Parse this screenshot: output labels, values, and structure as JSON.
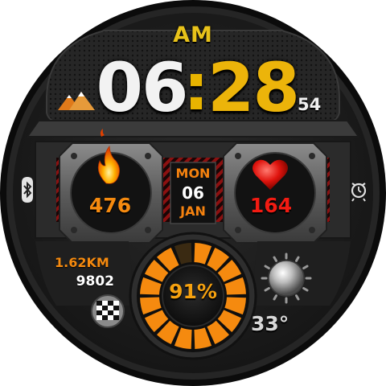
{
  "time": {
    "ampm": "AM",
    "hour": "06",
    "separator": ":",
    "minute": "28",
    "seconds": "54"
  },
  "date": {
    "day_of_week": "MON",
    "day": "06",
    "month": "JAN"
  },
  "fitness": {
    "calories": "476",
    "heart_rate": "164",
    "distance": "1.62KM",
    "steps": "9802"
  },
  "battery": {
    "percent": "91%",
    "level": 0.91
  },
  "weather": {
    "temperature": "33°",
    "condition_icon": "sun-icon"
  },
  "status_icons": {
    "left": "bluetooth-icon",
    "right": "alarm-clock-icon"
  },
  "colors": {
    "accent_orange": "#f58a0f",
    "hour_white": "#f2f2f2",
    "minute_yellow": "#ecb40a",
    "heart_red": "#f21b12",
    "bezel": "#1c1c1c"
  }
}
